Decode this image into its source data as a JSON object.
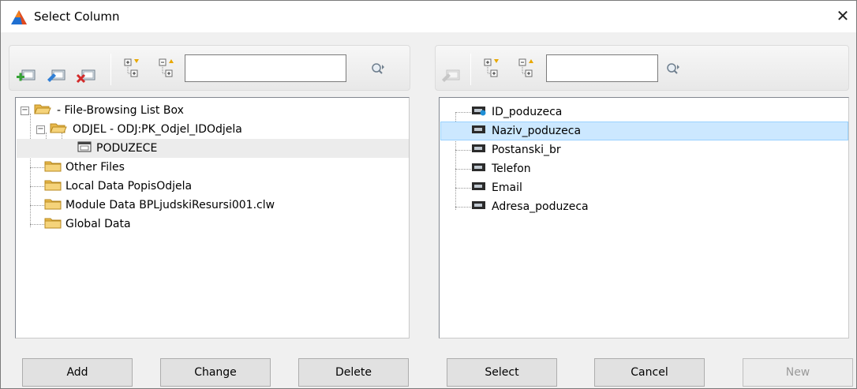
{
  "window": {
    "title": "Select Column",
    "close_glyph": "✕"
  },
  "left_toolbar": {
    "buttons": [
      {
        "name": "add-item-icon"
      },
      {
        "name": "edit-item-icon"
      },
      {
        "name": "delete-item-icon"
      },
      {
        "name": "expand-all-icon"
      },
      {
        "name": "collapse-all-icon"
      }
    ],
    "search_value": "",
    "find_icon": "find-next-icon"
  },
  "right_toolbar": {
    "search_value": "",
    "find_icon": "find-next-icon"
  },
  "left_tree": [
    {
      "label": "- File-Browsing List Box",
      "level": 0,
      "icon": "open-folder-icon",
      "expander": "−"
    },
    {
      "label": "ODJEL - ODJ:PK_Odjel_IDOdjela",
      "level": 1,
      "icon": "open-folder-icon",
      "expander": "−"
    },
    {
      "label": "PODUZECE",
      "level": 2,
      "icon": "table-icon",
      "selected": true
    },
    {
      "label": "Other Files",
      "level": 0,
      "icon": "folder-icon"
    },
    {
      "label": "Local Data PopisOdjela",
      "level": 0,
      "icon": "folder-icon"
    },
    {
      "label": "Module Data BPLjudskiResursi001.clw",
      "level": 0,
      "icon": "folder-icon"
    },
    {
      "label": "Global Data",
      "level": 0,
      "icon": "folder-icon"
    }
  ],
  "right_tree": [
    {
      "label": "ID_poduzeca",
      "icon": "key-field-icon"
    },
    {
      "label": "Naziv_poduzeca",
      "icon": "field-icon",
      "selected": true
    },
    {
      "label": "Postanski_br",
      "icon": "field-icon"
    },
    {
      "label": "Telefon",
      "icon": "field-icon"
    },
    {
      "label": "Email",
      "icon": "field-icon"
    },
    {
      "label": "Adresa_poduzeca",
      "icon": "field-icon"
    }
  ],
  "buttons": {
    "add": "Add",
    "change": "Change",
    "delete": "Delete",
    "select": "Select",
    "cancel": "Cancel",
    "new": "New"
  },
  "colors": {
    "selection": "#cce8ff",
    "selection_border": "#99d1ff",
    "folder": "#e8b84a"
  }
}
